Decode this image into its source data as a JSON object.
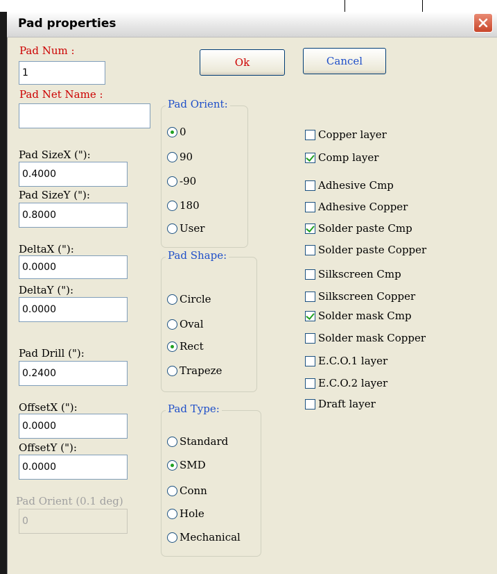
{
  "window": {
    "title": "Pad properties"
  },
  "fields": {
    "pad_num": {
      "label": "Pad Num :",
      "value": "1"
    },
    "pad_net_name": {
      "label": "Pad Net Name :",
      "value": ""
    },
    "pad_size_x": {
      "label": "Pad SizeX (\"):",
      "value": "0.4000"
    },
    "pad_size_y": {
      "label": "Pad SizeY (\"):",
      "value": "0.8000"
    },
    "delta_x": {
      "label": "DeltaX (\"):",
      "value": "0.0000"
    },
    "delta_y": {
      "label": "DeltaY (\"):",
      "value": "0.0000"
    },
    "pad_drill": {
      "label": "Pad Drill (\"):",
      "value": "0.2400"
    },
    "offset_x": {
      "label": "OffsetX (\"):",
      "value": "0.0000"
    },
    "offset_y": {
      "label": "OffsetY (\"):",
      "value": "0.0000"
    },
    "pad_orient_deg": {
      "label": "Pad Orient (0.1 deg)",
      "value": "0",
      "disabled": true
    }
  },
  "buttons": {
    "ok": "Ok",
    "cancel": "Cancel"
  },
  "pad_orient": {
    "title": "Pad Orient:",
    "options": [
      {
        "label": "0",
        "selected": true
      },
      {
        "label": "90",
        "selected": false
      },
      {
        "label": "-90",
        "selected": false
      },
      {
        "label": "180",
        "selected": false
      },
      {
        "label": "User",
        "selected": false
      }
    ]
  },
  "pad_shape": {
    "title": "Pad Shape:",
    "options": [
      {
        "label": "Circle",
        "selected": false
      },
      {
        "label": "Oval",
        "selected": false
      },
      {
        "label": "Rect",
        "selected": true
      },
      {
        "label": "Trapeze",
        "selected": false
      }
    ]
  },
  "pad_type": {
    "title": "Pad Type:",
    "options": [
      {
        "label": "Standard",
        "selected": false
      },
      {
        "label": "SMD",
        "selected": true
      },
      {
        "label": "Conn",
        "selected": false
      },
      {
        "label": "Hole",
        "selected": false
      },
      {
        "label": "Mechanical",
        "selected": false
      }
    ]
  },
  "layers": [
    {
      "label": "Copper layer",
      "checked": false
    },
    {
      "label": "Comp layer",
      "checked": true
    },
    {
      "label": "Adhesive Cmp",
      "checked": false
    },
    {
      "label": "Adhesive Copper",
      "checked": false
    },
    {
      "label": "Solder paste Cmp",
      "checked": true
    },
    {
      "label": "Solder paste Copper",
      "checked": false
    },
    {
      "label": "Silkscreen Cmp",
      "checked": false
    },
    {
      "label": "Silkscreen Copper",
      "checked": false
    },
    {
      "label": "Solder mask Cmp",
      "checked": true
    },
    {
      "label": "Solder mask Copper",
      "checked": false
    },
    {
      "label": "E.C.O.1 layer",
      "checked": false
    },
    {
      "label": "E.C.O.2 layer",
      "checked": false
    },
    {
      "label": "Draft layer",
      "checked": false
    }
  ],
  "colors": {
    "label_red": "#cc0000",
    "group_title_blue": "#1f4fc9",
    "check_green": "#21a121"
  }
}
